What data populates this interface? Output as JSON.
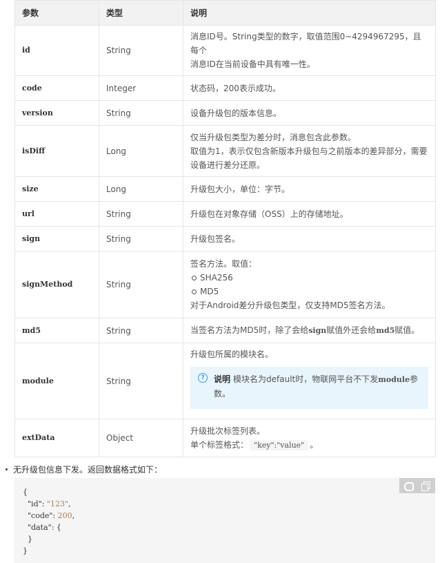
{
  "table": {
    "headers": {
      "param": "参数",
      "type": "类型",
      "desc": "说明"
    },
    "rows": [
      {
        "name": "id",
        "type": "String",
        "desc": [
          "消息ID号。String类型的数字，取值范围0~4294967295，且每个",
          "消息ID在当前设备中具有唯一性。"
        ]
      },
      {
        "name": "code",
        "type": "Integer",
        "desc": [
          "状态码，200表示成功。"
        ]
      },
      {
        "name": "version",
        "type": "String",
        "desc": [
          "设备升级包的版本信息。"
        ]
      },
      {
        "name": "isDiff",
        "type": "Long",
        "desc": [
          "仅当升级包类型为差分时，消息包含此参数。",
          "取值为1，表示仅包含新版本升级包与之前版本的差异部分，需要",
          "设备进行差分还原。"
        ]
      },
      {
        "name": "size",
        "type": "Long",
        "desc": [
          "升级包大小，单位：字节。"
        ]
      },
      {
        "name": "url",
        "type": "String",
        "desc": [
          "升级包在对象存储（OSS）上的存储地址。"
        ]
      },
      {
        "name": "sign",
        "type": "String",
        "desc": [
          "升级包签名。"
        ]
      },
      {
        "name": "signMethod",
        "type": "String",
        "desc_intro": "签名方法。取值：",
        "options": [
          "SHA256",
          "MD5"
        ],
        "desc_outro": "对于Android差分升级包类型，仅支持MD5签名方法。"
      },
      {
        "name": "md5",
        "type": "String",
        "desc_parts": [
          "当签名方法为MD5时，除了会给",
          "sign",
          "赋值外还会给",
          "md5",
          "赋值。"
        ]
      },
      {
        "name": "module",
        "type": "String",
        "desc": [
          "升级包所属的模块名。"
        ],
        "note": {
          "label": "说明",
          "text1": "模块名为default时，物联网平台不下发",
          "code": "module",
          "text2": "参",
          "text3": "数。"
        }
      },
      {
        "name": "extData",
        "type": "Object",
        "desc": [
          "升级批次标签列表。"
        ],
        "format_label": "单个标签格式：",
        "format_code": "\"key\":\"value\"",
        "format_end": "。"
      }
    ]
  },
  "bullet": {
    "text": "无升级包信息下发。返回数据格式如下："
  },
  "code": {
    "lines": [
      "{",
      "  \"id\": \"123\",",
      "  \"code\": 200,",
      "  \"data\": {",
      "  }",
      "}"
    ],
    "tok_id_key": "\"id\"",
    "tok_id_val": "\"123\"",
    "tok_code_key": "\"code\"",
    "tok_code_val": "200",
    "tok_data_key": "\"data\""
  }
}
